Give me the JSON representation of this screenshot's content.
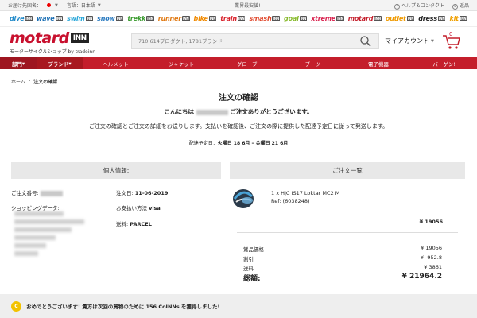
{
  "topbar": {
    "shipping_label": "お届け先国名：",
    "language_label": "言語：日本語",
    "center_text": "業界最安値!",
    "help_label": "ヘルプ＆コンタクト",
    "returns_label": "返品"
  },
  "shops": [
    {
      "name": "dive",
      "color": "#1e88c8"
    },
    {
      "name": "wave",
      "color": "#1c6fb4"
    },
    {
      "name": "swim",
      "color": "#2aa7d9"
    },
    {
      "name": "snow",
      "color": "#2b7bc0"
    },
    {
      "name": "trekk",
      "color": "#3a9b2e"
    },
    {
      "name": "runner",
      "color": "#e07a14"
    },
    {
      "name": "bike",
      "color": "#f08a00"
    },
    {
      "name": "train",
      "color": "#d9232d"
    },
    {
      "name": "smash",
      "color": "#e0462a"
    },
    {
      "name": "goal",
      "color": "#86b92a"
    },
    {
      "name": "xtreme",
      "color": "#d81e4b"
    },
    {
      "name": "motard",
      "color": "#c41e2b"
    },
    {
      "name": "outlet",
      "color": "#f09a00"
    },
    {
      "name": "dress",
      "color": "#222222"
    },
    {
      "name": "kit",
      "color": "#f0a000"
    }
  ],
  "shop_tag": "INN",
  "header": {
    "logo_main": "motard",
    "logo_inn": "INN",
    "logo_sub": "モーターサイクルショップ by tradeinn",
    "search_placeholder": "710.614プロダクト, 1781ブランド",
    "account_label": "マイアカウント",
    "cart_count": "0"
  },
  "nav": {
    "items": [
      "部門",
      "ブランド",
      "ヘルメット",
      "ジャケット",
      "グローブ",
      "ブーツ",
      "電子機器",
      "バーゲン!"
    ]
  },
  "breadcrumb": {
    "home": "ホーム",
    "sep": "›",
    "current": "注文の確認"
  },
  "confirm": {
    "title": "注文の確認",
    "greet_pre": "こんにちは",
    "greet_post": "ご注文ありがとうございます。",
    "info": "ご注文の確認とご注文の詳細をお送りします。支払いを確認後、ご注文の際に提供した配達予定日に従って発送します。",
    "delivery_label": "配達予定日：",
    "delivery_dates": "火曜日 18 6月 – 金曜日 21 6月"
  },
  "personal": {
    "heading": "個人情報:",
    "order_no_label": "ご注文番号:",
    "shipping_label": "ショッピングデータ:",
    "order_date_label": "注文日:",
    "order_date": "11-06-2019",
    "payment_label": "お支払い方法",
    "payment_value": "visa",
    "shipping_fee_label": "送料:",
    "shipping_fee_value": "PARCEL"
  },
  "order": {
    "heading": "ご注文一覧",
    "product_name": "1 x HJC IS17 Loktar MC2 M",
    "product_ref": "Ref: (6038248)",
    "product_price": "¥ 19056",
    "subtotal_label": "賞品価格",
    "subtotal_value": "¥ 19056",
    "discount_label": "割引",
    "discount_value": "¥ -952.8",
    "shipping_label": "送料",
    "shipping_value": "¥ 3861",
    "total_label": "総額:",
    "total_value": "¥ 21964.2"
  },
  "banner": {
    "coin_icon": "C",
    "text": "おめでとうございます! 貴方は次回の買物のために 156 CoINNs を獲得しました!"
  }
}
